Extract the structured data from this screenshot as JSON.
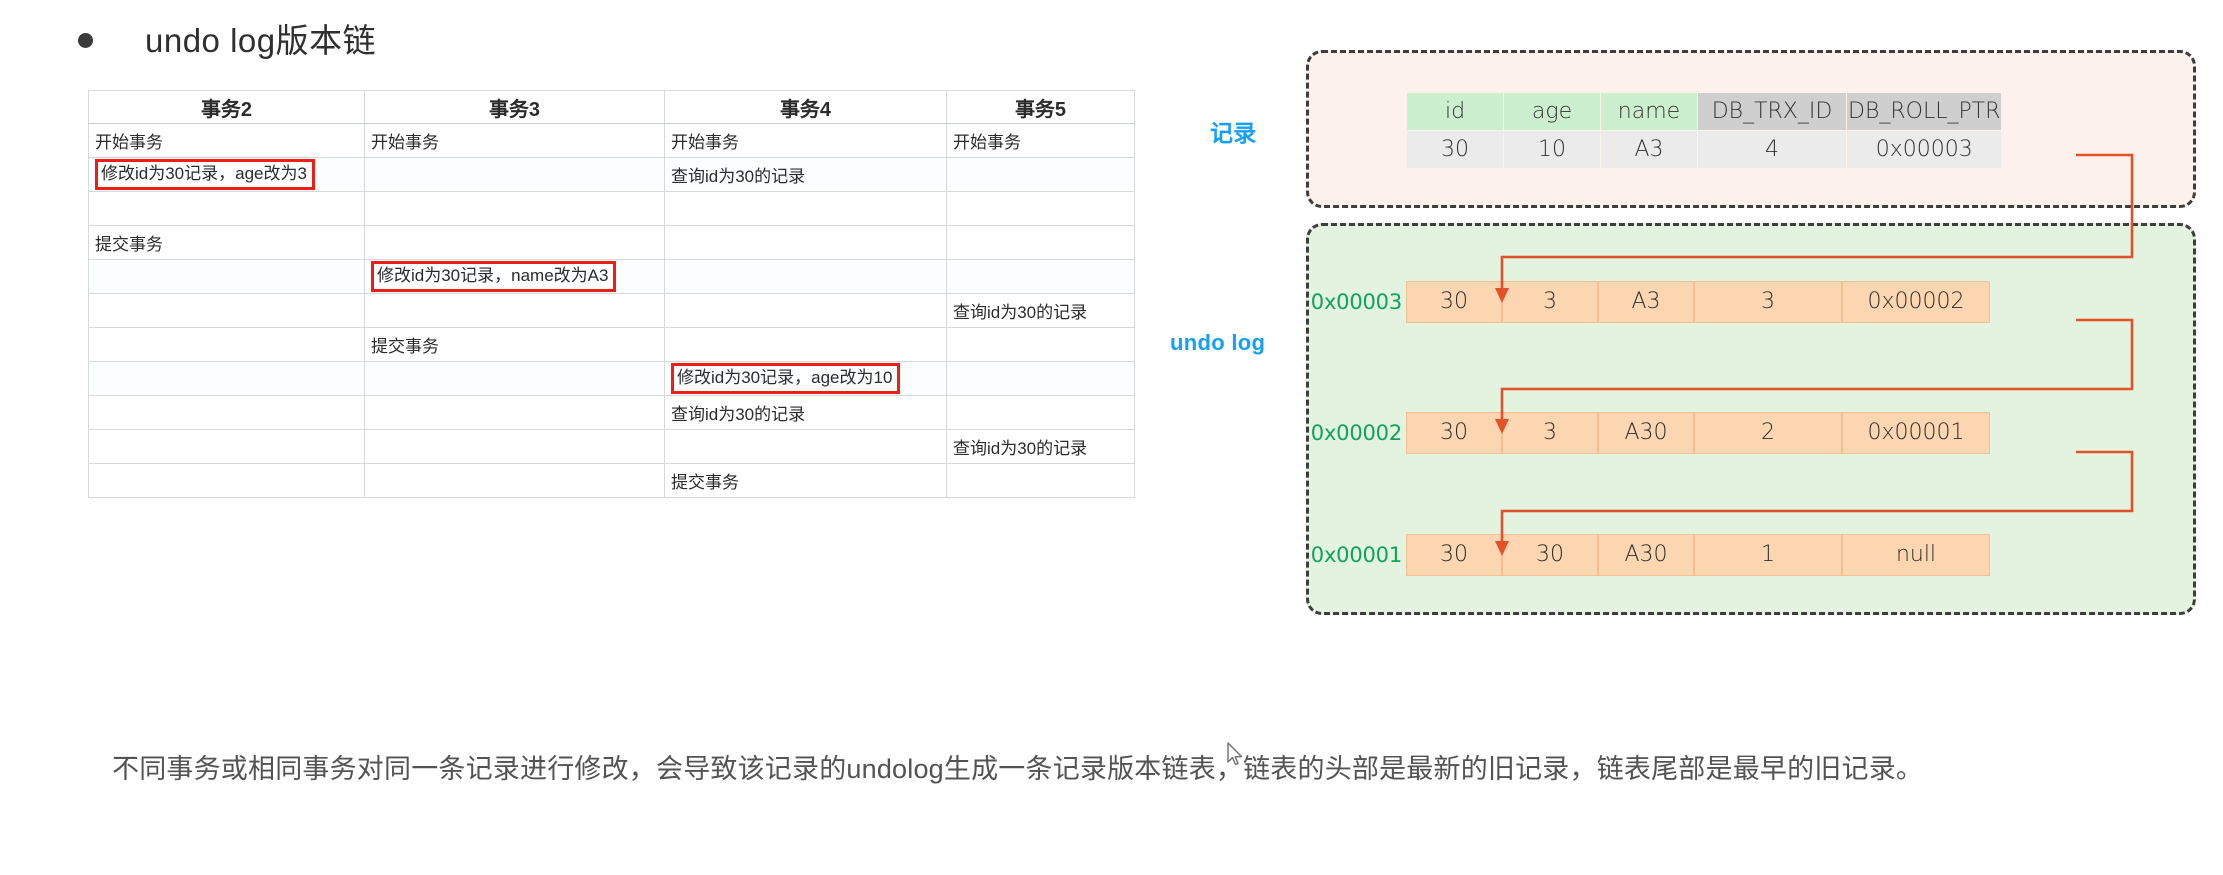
{
  "heading": {
    "bullet_icon": "bullet-dot",
    "text": "undo log版本链"
  },
  "txn_table": {
    "headers": [
      "事务2",
      "事务3",
      "事务4",
      "事务5"
    ],
    "rows": [
      {
        "cells": [
          "开始事务",
          "开始事务",
          "开始事务",
          "开始事务"
        ],
        "highlight": [
          false,
          false,
          false,
          false
        ]
      },
      {
        "cells": [
          "修改id为30记录，age改为3",
          "",
          "查询id为30的记录",
          ""
        ],
        "highlight": [
          true,
          false,
          false,
          false
        ]
      },
      {
        "cells": [
          "",
          "",
          "",
          ""
        ],
        "highlight": [
          false,
          false,
          false,
          false
        ]
      },
      {
        "cells": [
          "提交事务",
          "",
          "",
          ""
        ],
        "highlight": [
          false,
          false,
          false,
          false
        ]
      },
      {
        "cells": [
          "",
          "修改id为30记录，name改为A3",
          "",
          ""
        ],
        "highlight": [
          false,
          true,
          false,
          false
        ]
      },
      {
        "cells": [
          "",
          "",
          "",
          "查询id为30的记录"
        ],
        "highlight": [
          false,
          false,
          false,
          false
        ]
      },
      {
        "cells": [
          "",
          "提交事务",
          "",
          ""
        ],
        "highlight": [
          false,
          false,
          false,
          false
        ]
      },
      {
        "cells": [
          "",
          "",
          "修改id为30记录，age改为10",
          ""
        ],
        "highlight": [
          false,
          false,
          true,
          false
        ]
      },
      {
        "cells": [
          "",
          "",
          "查询id为30的记录",
          ""
        ],
        "highlight": [
          false,
          false,
          false,
          false
        ]
      },
      {
        "cells": [
          "",
          "",
          "",
          "查询id为30的记录"
        ],
        "highlight": [
          false,
          false,
          false,
          false
        ]
      },
      {
        "cells": [
          "",
          "",
          "提交事务",
          ""
        ],
        "highlight": [
          false,
          false,
          false,
          false
        ]
      }
    ]
  },
  "diagram": {
    "record_label": "记录",
    "undo_label": "undo log",
    "record_table": {
      "headers": [
        "id",
        "age",
        "name",
        "DB_TRX_ID",
        "DB_ROLL_PTR"
      ],
      "values": [
        "30",
        "10",
        "A3",
        "4",
        "0x00003"
      ]
    },
    "undo_rows": [
      {
        "address": "0x00003",
        "values": [
          "30",
          "3",
          "A3",
          "3",
          "0x00002"
        ]
      },
      {
        "address": "0x00002",
        "values": [
          "30",
          "3",
          "A30",
          "2",
          "0x00001"
        ]
      },
      {
        "address": "0x00001",
        "values": [
          "30",
          "30",
          "A30",
          "1",
          "null"
        ]
      }
    ],
    "colors": {
      "label_blue": "#14a0f7",
      "address_green": "#0fa35b",
      "record_box_bg": "#fdf1ec",
      "undo_box_bg": "#e3f3e0",
      "header_green": "#ccf0cd",
      "header_grey": "#cfcfcf",
      "undo_cell": "#fbd6b1",
      "arrow": "#e2512a",
      "highlight_red": "#ee1d16"
    }
  },
  "paragraph": {
    "text": "不同事务或相同事务对同一条记录进行修改，会导致该记录的undolog生成一条记录版本链表，链表的头部是最新的旧记录，链表尾部是最早的旧记录。"
  }
}
